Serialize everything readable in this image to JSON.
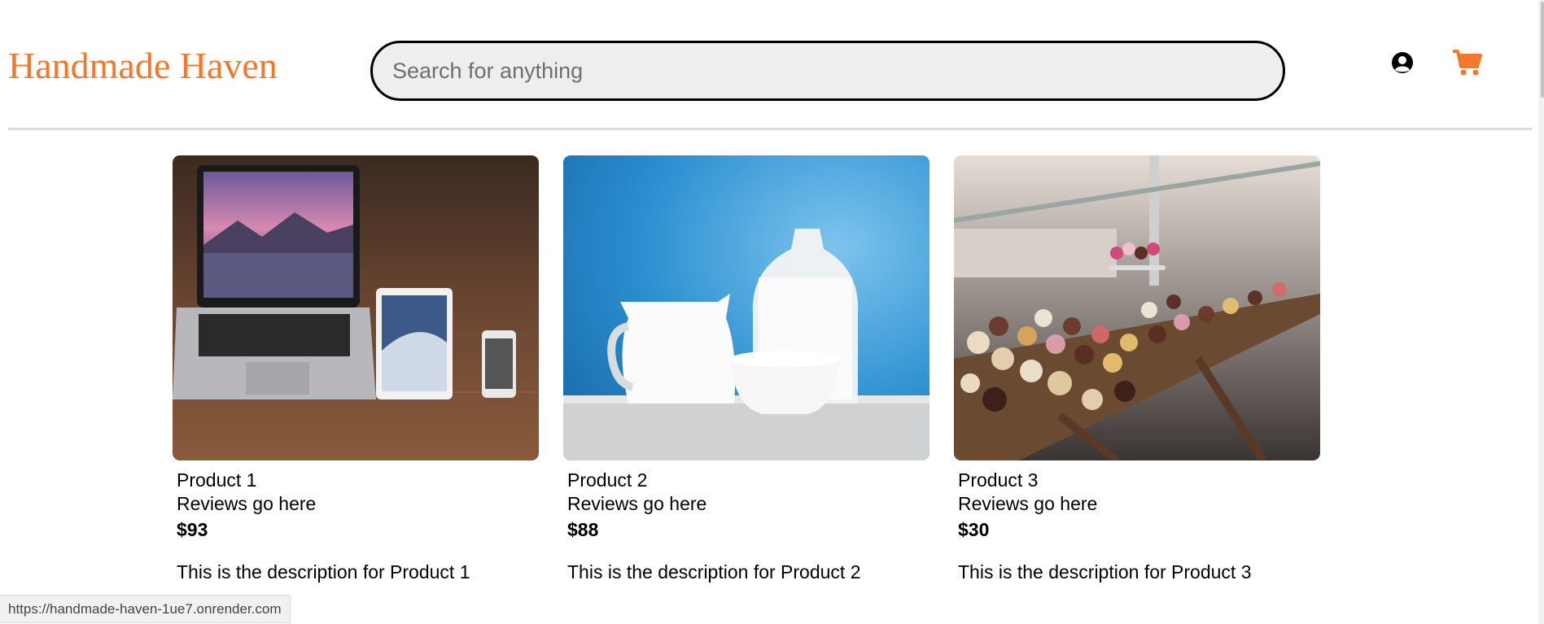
{
  "header": {
    "logo": "Handmade Haven",
    "search_placeholder": "Search for anything",
    "accent_color": "#f2782b",
    "icons": [
      "user-circle-icon",
      "shopping-cart-icon"
    ]
  },
  "products": [
    {
      "name": "Product 1",
      "reviews": "Reviews go here",
      "price": "$93",
      "description": "This is the description for Product 1",
      "image": "laptop-tablet-phone-photo"
    },
    {
      "name": "Product 2",
      "reviews": "Reviews go here",
      "price": "$88",
      "description": "This is the description for Product 2",
      "image": "milk-jugs-photo"
    },
    {
      "name": "Product 3",
      "reviews": "Reviews go here",
      "price": "$30",
      "description": "This is the description for Product 3",
      "image": "pastry-display-photo"
    }
  ],
  "status_bar": {
    "url": "https://handmade-haven-1ue7.onrender.com"
  }
}
